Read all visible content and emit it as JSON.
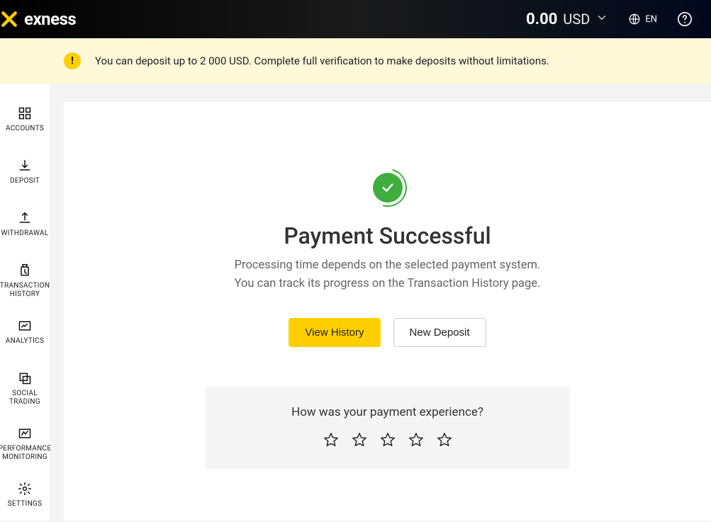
{
  "brand": {
    "name": "exness"
  },
  "header": {
    "balance_amount": "0.00",
    "balance_currency": "USD",
    "language": "EN"
  },
  "banner": {
    "text": "You can deposit up to 2 000 USD. Complete full verification to make deposits without limitations."
  },
  "sidebar": {
    "items": [
      {
        "label": "ACCOUNTS"
      },
      {
        "label": "DEPOSIT"
      },
      {
        "label": "WITHDRAWAL"
      },
      {
        "label": "TRANSACTION HISTORY"
      },
      {
        "label": "ANALYTICS"
      },
      {
        "label": "SOCIAL TRADING"
      },
      {
        "label": "PERFORMANCE MONITORING"
      },
      {
        "label": "SETTINGS"
      }
    ]
  },
  "main": {
    "title": "Payment Successful",
    "subtitle_line1": "Processing time depends on the selected payment system.",
    "subtitle_line2": "You can track its progress on the Transaction History page.",
    "view_history_label": "View History",
    "new_deposit_label": "New Deposit",
    "rating_question": "How was your payment experience?"
  }
}
